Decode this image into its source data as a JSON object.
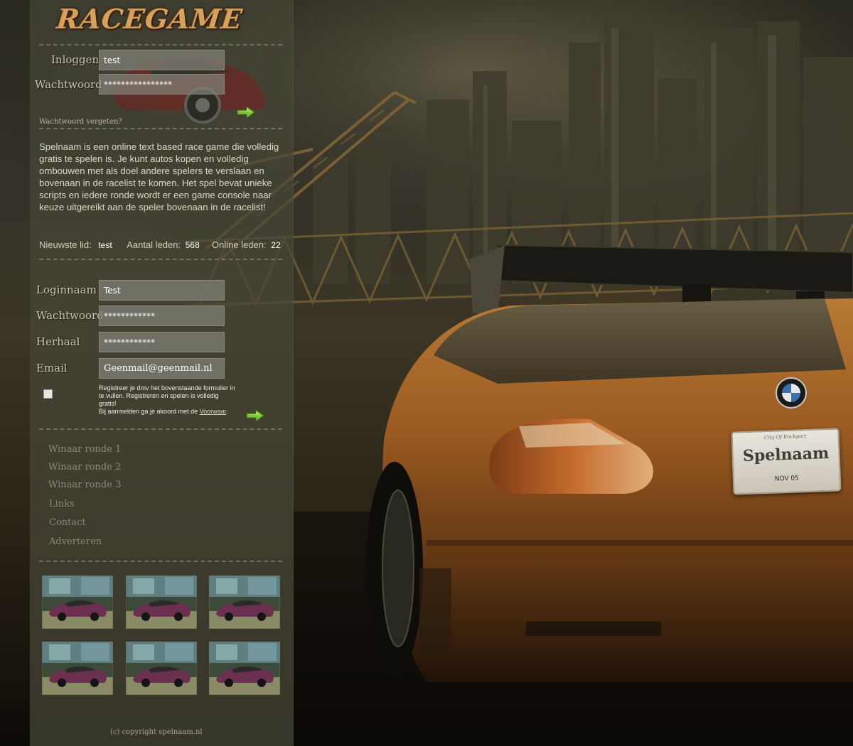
{
  "site": {
    "logo_text": "RACEGAME"
  },
  "login": {
    "username_label": "Inloggen",
    "username_value": "test",
    "password_label": "Wachtwoord",
    "password_value": "****************",
    "forgot_link": "Wachtwoord  vergeten?",
    "submit_icon": "arrow-right-icon"
  },
  "intro": {
    "text": "Spelnaam is een online text based race game die volledig gratis te spelen is. Je kunt autos kopen en volledig ombouwen met als doel andere spelers te verslaan en bovenaan in de racelist te komen. Het spel bevat unieke scripts en iedere ronde wordt er een game console naar keuze uitgereikt aan de speler bovenaan in de racelist!"
  },
  "stats": {
    "newest_label": "Nieuwste lid:",
    "newest_value": "test",
    "members_label": "Aantal leden:",
    "members_value": "568",
    "online_label": "Online leden:",
    "online_value": "22"
  },
  "register": {
    "login_label": "Loginnaam",
    "login_value": "Test",
    "password_label": "Wachtwoord",
    "password_value": "************",
    "repeat_label": "Herhaal",
    "repeat_value": "************",
    "email_label": "Email",
    "email_value": "Geenmail@geenmail.nl",
    "note_line1": "Registreer je dmv het bovenstaande formulier in te vullen. Registreren en spelen is volledig gratis!",
    "note_line2": "Bij aanmelden ga je akoord met de ",
    "terms_link": "Voorwaar",
    "note_end": ".",
    "submit_icon": "arrow-right-icon"
  },
  "nav": {
    "items": [
      "Winaar ronde 1",
      "Winaar ronde 2",
      "Winaar ronde 3",
      "Links",
      "Contact",
      "Adverteren"
    ]
  },
  "gallery": {
    "count": 6,
    "thumb_icon": "car-screenshot-thumbnail"
  },
  "footer": {
    "copyright": "(c) copyright spelnaam.nl"
  },
  "background": {
    "plate_top": "City Of Rockport",
    "plate_name": "Spelnaam",
    "plate_tag": "NOV 05",
    "badge_icon": "bmw-badge-icon"
  },
  "colors": {
    "panel": "#46463a",
    "accent_orange": "#c8782a",
    "arrow_green": "#7fc23a",
    "logo": "#d6a15a"
  }
}
